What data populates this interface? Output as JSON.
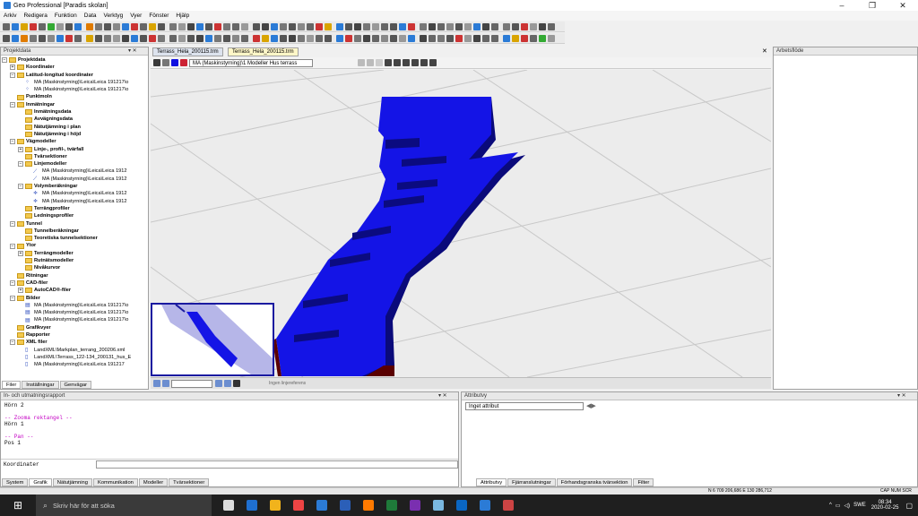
{
  "window": {
    "title": "Geo Professional [Paradis skolan]",
    "minimize": "–",
    "maximize": "❐",
    "close": "✕"
  },
  "menu": [
    "Arkiv",
    "Redigera",
    "Funktion",
    "Data",
    "Verktyg",
    "Vyer",
    "Fönster",
    "Hjälp"
  ],
  "project_panel": {
    "title": "Projektdata",
    "items": [
      {
        "label": "Projektdata",
        "level": 0,
        "kind": "folder",
        "bold": true,
        "toggle": "−"
      },
      {
        "label": "Koordinater",
        "level": 1,
        "kind": "folder",
        "bold": true,
        "toggle": "+"
      },
      {
        "label": "Latitud-longitud koordinater",
        "level": 1,
        "kind": "folder",
        "bold": true,
        "toggle": "−"
      },
      {
        "label": "MA (Maskinstyrning)\\Leica\\Leica 191217\\o",
        "level": 2,
        "kind": "points"
      },
      {
        "label": "MA (Maskinstyrning)\\Leica\\Leica 191217\\o",
        "level": 2,
        "kind": "points"
      },
      {
        "label": "Punktmoln",
        "level": 1,
        "kind": "folder",
        "bold": true
      },
      {
        "label": "Inmätningar",
        "level": 1,
        "kind": "folder",
        "bold": true,
        "toggle": "−"
      },
      {
        "label": "Inmätningsdata",
        "level": 2,
        "kind": "folder",
        "bold": true
      },
      {
        "label": "Avvägningsdata",
        "level": 2,
        "kind": "folder",
        "bold": true
      },
      {
        "label": "Nätutjämning i plan",
        "level": 2,
        "kind": "folder",
        "bold": true
      },
      {
        "label": "Nätutjämning i höjd",
        "level": 2,
        "kind": "folder",
        "bold": true
      },
      {
        "label": "Vägmodeller",
        "level": 1,
        "kind": "folder",
        "bold": true,
        "toggle": "−"
      },
      {
        "label": "Linje-, profil-, tvärfall",
        "level": 2,
        "kind": "folder",
        "bold": true,
        "toggle": "+"
      },
      {
        "label": "Tvärsektioner",
        "level": 2,
        "kind": "folder",
        "bold": true
      },
      {
        "label": "Linjemodeller",
        "level": 2,
        "kind": "folder",
        "bold": true,
        "toggle": "−"
      },
      {
        "label": "MA (Maskinstyrning)\\Leica\\Leica 1912",
        "level": 3,
        "kind": "line"
      },
      {
        "label": "MA (Maskinstyrning)\\Leica\\Leica 1912",
        "level": 3,
        "kind": "line"
      },
      {
        "label": "Volymberäkningar",
        "level": 2,
        "kind": "folder",
        "bold": true,
        "toggle": "−"
      },
      {
        "label": "MA (Maskinstyrning)\\Leica\\Leica 1912",
        "level": 3,
        "kind": "volume"
      },
      {
        "label": "MA (Maskinstyrning)\\Leica\\Leica 1912",
        "level": 3,
        "kind": "volume"
      },
      {
        "label": "Terrängprofiler",
        "level": 2,
        "kind": "folder",
        "bold": true
      },
      {
        "label": "Ledningsprofiler",
        "level": 2,
        "kind": "folder",
        "bold": true
      },
      {
        "label": "Tunnel",
        "level": 1,
        "kind": "folder",
        "bold": true,
        "toggle": "−"
      },
      {
        "label": "Tunnelberäkningar",
        "level": 2,
        "kind": "folder",
        "bold": true
      },
      {
        "label": "Teoretiska tunnelsektioner",
        "level": 2,
        "kind": "folder",
        "bold": true
      },
      {
        "label": "Ytor",
        "level": 1,
        "kind": "folder",
        "bold": true,
        "toggle": "−"
      },
      {
        "label": "Terrängmodeller",
        "level": 2,
        "kind": "folder",
        "bold": true,
        "toggle": "+"
      },
      {
        "label": "Rutnätsmodeller",
        "level": 2,
        "kind": "folder",
        "bold": true
      },
      {
        "label": "Nivåkurvor",
        "level": 2,
        "kind": "folder",
        "bold": true
      },
      {
        "label": "Ritningar",
        "level": 1,
        "kind": "folder",
        "bold": true
      },
      {
        "label": "CAD-filer",
        "level": 1,
        "kind": "folder",
        "bold": true,
        "toggle": "−"
      },
      {
        "label": "AutoCAD®-filer",
        "level": 2,
        "kind": "folder",
        "bold": true,
        "toggle": "+"
      },
      {
        "label": "Bilder",
        "level": 1,
        "kind": "folder",
        "bold": true,
        "toggle": "−"
      },
      {
        "label": "MA (Maskinstyrning)\\Leica\\Leica 191217\\o",
        "level": 2,
        "kind": "image"
      },
      {
        "label": "MA (Maskinstyrning)\\Leica\\Leica 191217\\o",
        "level": 2,
        "kind": "image"
      },
      {
        "label": "MA (Maskinstyrning)\\Leica\\Leica 191217\\o",
        "level": 2,
        "kind": "image"
      },
      {
        "label": "Grafikvyer",
        "level": 1,
        "kind": "folder",
        "bold": true
      },
      {
        "label": "Rapporter",
        "level": 1,
        "kind": "folder",
        "bold": true
      },
      {
        "label": "XML filer",
        "level": 1,
        "kind": "folder",
        "bold": true,
        "toggle": "−"
      },
      {
        "label": "LandXML\\Markplan_terrang_200206.xml",
        "level": 2,
        "kind": "file"
      },
      {
        "label": "LandXML\\Terrass_122-134_200131_hus_E",
        "level": 2,
        "kind": "file"
      },
      {
        "label": "MA (Maskinstyrning)\\Leica\\Leica 191217",
        "level": 2,
        "kind": "file"
      }
    ],
    "tabs": [
      "Filer",
      "Inställningar",
      "Genvägar"
    ]
  },
  "doc_tabs": [
    "Terrass_Hela_200115.trm",
    "Terrass_Hela_200115.trm"
  ],
  "view_toolbar": {
    "model_combo": "MA (Maskinstyrning)\\1 Modeller Hus terrass"
  },
  "view_status": {
    "reference": "Ingen linjereferens"
  },
  "workflow_panel": {
    "title": "Arbetsflöde"
  },
  "command_panel": {
    "title": "In- och utmatningsrapport",
    "lines": [
      {
        "text": "Hörn 2",
        "style": "normal"
      },
      {
        "text": "",
        "style": "normal"
      },
      {
        "text": "-- Zooma rektangel --",
        "style": "pink"
      },
      {
        "text": "Hörn 1",
        "style": "normal"
      },
      {
        "text": "",
        "style": "normal"
      },
      {
        "text": "-- Pan --",
        "style": "pink"
      },
      {
        "text": "Pos 1",
        "style": "normal"
      }
    ],
    "coord_label": "Koordinater",
    "tabs": [
      "System",
      "Grafik",
      "Nätutjämning",
      "Kommunikation",
      "Modeller",
      "Tvärsektioner"
    ]
  },
  "attribute_panel": {
    "title": "Attributvy",
    "combo": "Inget attribut",
    "tabs": [
      "Attributvy",
      "Fjärranslutningar",
      "Förhandsgranska tvärsektion",
      "Filter"
    ]
  },
  "status": {
    "coords": "N 6 709 206,686  E 130 286,712",
    "indicators": "CAP  NUM  SCR"
  },
  "taskbar": {
    "search_placeholder": "Skriv här för att söka",
    "lang": "SWE",
    "time": "08:34",
    "date": "2020-02-25"
  },
  "colors": {
    "model": "#1010e0",
    "model_dark": "#0a0a7a",
    "accent": "#2b5fb8"
  }
}
